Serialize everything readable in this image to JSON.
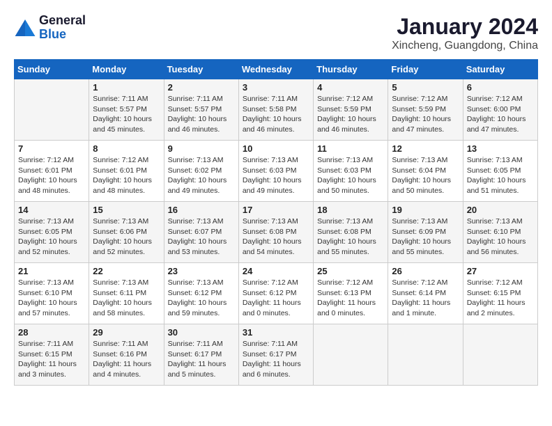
{
  "header": {
    "logo_line1": "General",
    "logo_line2": "Blue",
    "month": "January 2024",
    "location": "Xincheng, Guangdong, China"
  },
  "days_of_week": [
    "Sunday",
    "Monday",
    "Tuesday",
    "Wednesday",
    "Thursday",
    "Friday",
    "Saturday"
  ],
  "weeks": [
    [
      {
        "date": "",
        "info": ""
      },
      {
        "date": "1",
        "info": "Sunrise: 7:11 AM\nSunset: 5:57 PM\nDaylight: 10 hours\nand 45 minutes."
      },
      {
        "date": "2",
        "info": "Sunrise: 7:11 AM\nSunset: 5:57 PM\nDaylight: 10 hours\nand 46 minutes."
      },
      {
        "date": "3",
        "info": "Sunrise: 7:11 AM\nSunset: 5:58 PM\nDaylight: 10 hours\nand 46 minutes."
      },
      {
        "date": "4",
        "info": "Sunrise: 7:12 AM\nSunset: 5:59 PM\nDaylight: 10 hours\nand 46 minutes."
      },
      {
        "date": "5",
        "info": "Sunrise: 7:12 AM\nSunset: 5:59 PM\nDaylight: 10 hours\nand 47 minutes."
      },
      {
        "date": "6",
        "info": "Sunrise: 7:12 AM\nSunset: 6:00 PM\nDaylight: 10 hours\nand 47 minutes."
      }
    ],
    [
      {
        "date": "7",
        "info": "Sunrise: 7:12 AM\nSunset: 6:01 PM\nDaylight: 10 hours\nand 48 minutes."
      },
      {
        "date": "8",
        "info": "Sunrise: 7:12 AM\nSunset: 6:01 PM\nDaylight: 10 hours\nand 48 minutes."
      },
      {
        "date": "9",
        "info": "Sunrise: 7:13 AM\nSunset: 6:02 PM\nDaylight: 10 hours\nand 49 minutes."
      },
      {
        "date": "10",
        "info": "Sunrise: 7:13 AM\nSunset: 6:03 PM\nDaylight: 10 hours\nand 49 minutes."
      },
      {
        "date": "11",
        "info": "Sunrise: 7:13 AM\nSunset: 6:03 PM\nDaylight: 10 hours\nand 50 minutes."
      },
      {
        "date": "12",
        "info": "Sunrise: 7:13 AM\nSunset: 6:04 PM\nDaylight: 10 hours\nand 50 minutes."
      },
      {
        "date": "13",
        "info": "Sunrise: 7:13 AM\nSunset: 6:05 PM\nDaylight: 10 hours\nand 51 minutes."
      }
    ],
    [
      {
        "date": "14",
        "info": "Sunrise: 7:13 AM\nSunset: 6:05 PM\nDaylight: 10 hours\nand 52 minutes."
      },
      {
        "date": "15",
        "info": "Sunrise: 7:13 AM\nSunset: 6:06 PM\nDaylight: 10 hours\nand 52 minutes."
      },
      {
        "date": "16",
        "info": "Sunrise: 7:13 AM\nSunset: 6:07 PM\nDaylight: 10 hours\nand 53 minutes."
      },
      {
        "date": "17",
        "info": "Sunrise: 7:13 AM\nSunset: 6:08 PM\nDaylight: 10 hours\nand 54 minutes."
      },
      {
        "date": "18",
        "info": "Sunrise: 7:13 AM\nSunset: 6:08 PM\nDaylight: 10 hours\nand 55 minutes."
      },
      {
        "date": "19",
        "info": "Sunrise: 7:13 AM\nSunset: 6:09 PM\nDaylight: 10 hours\nand 55 minutes."
      },
      {
        "date": "20",
        "info": "Sunrise: 7:13 AM\nSunset: 6:10 PM\nDaylight: 10 hours\nand 56 minutes."
      }
    ],
    [
      {
        "date": "21",
        "info": "Sunrise: 7:13 AM\nSunset: 6:10 PM\nDaylight: 10 hours\nand 57 minutes."
      },
      {
        "date": "22",
        "info": "Sunrise: 7:13 AM\nSunset: 6:11 PM\nDaylight: 10 hours\nand 58 minutes."
      },
      {
        "date": "23",
        "info": "Sunrise: 7:13 AM\nSunset: 6:12 PM\nDaylight: 10 hours\nand 59 minutes."
      },
      {
        "date": "24",
        "info": "Sunrise: 7:12 AM\nSunset: 6:12 PM\nDaylight: 11 hours\nand 0 minutes."
      },
      {
        "date": "25",
        "info": "Sunrise: 7:12 AM\nSunset: 6:13 PM\nDaylight: 11 hours\nand 0 minutes."
      },
      {
        "date": "26",
        "info": "Sunrise: 7:12 AM\nSunset: 6:14 PM\nDaylight: 11 hours\nand 1 minute."
      },
      {
        "date": "27",
        "info": "Sunrise: 7:12 AM\nSunset: 6:15 PM\nDaylight: 11 hours\nand 2 minutes."
      }
    ],
    [
      {
        "date": "28",
        "info": "Sunrise: 7:11 AM\nSunset: 6:15 PM\nDaylight: 11 hours\nand 3 minutes."
      },
      {
        "date": "29",
        "info": "Sunrise: 7:11 AM\nSunset: 6:16 PM\nDaylight: 11 hours\nand 4 minutes."
      },
      {
        "date": "30",
        "info": "Sunrise: 7:11 AM\nSunset: 6:17 PM\nDaylight: 11 hours\nand 5 minutes."
      },
      {
        "date": "31",
        "info": "Sunrise: 7:11 AM\nSunset: 6:17 PM\nDaylight: 11 hours\nand 6 minutes."
      },
      {
        "date": "",
        "info": ""
      },
      {
        "date": "",
        "info": ""
      },
      {
        "date": "",
        "info": ""
      }
    ]
  ]
}
